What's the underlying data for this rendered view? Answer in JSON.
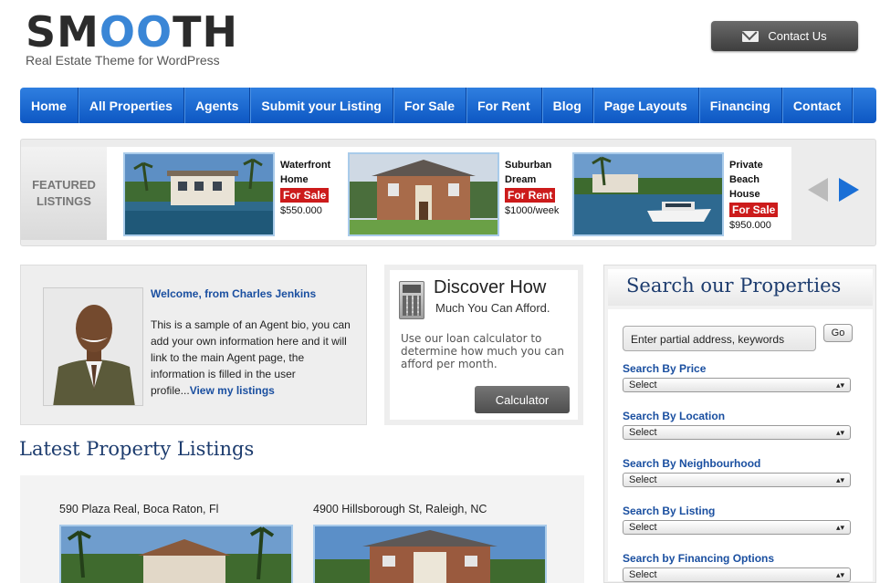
{
  "header": {
    "logo_prefix": "SM",
    "logo_oo": "OO",
    "logo_suffix": "TH",
    "tagline": "Real Estate Theme for WordPress",
    "contact_label": "Contact Us"
  },
  "nav": {
    "items": [
      "Home",
      "All Properties",
      "Agents",
      "Submit your Listing",
      "For Sale",
      "For Rent",
      "Blog",
      "Page Layouts",
      "Financing",
      "Contact"
    ]
  },
  "featured": {
    "label_line1": "FEATURED",
    "label_line2": "LISTINGS",
    "cards": [
      {
        "title_line1": "Waterfront",
        "title_line2": "Home",
        "title_line3": "",
        "badge": "For Sale",
        "price": "$550.000"
      },
      {
        "title_line1": "Suburban",
        "title_line2": "Dream",
        "title_line3": "",
        "badge": "For Rent",
        "price": "$1000/week"
      },
      {
        "title_line1": "Private",
        "title_line2": "Beach",
        "title_line3": "House",
        "badge": "For Sale",
        "price": "$950.000"
      }
    ]
  },
  "agent": {
    "title": "Welcome, from Charles Jenkins",
    "bio": "This is a sample of an Agent bio, you can add your own information here and it will link to the main Agent page, the information is filled in the user profile...",
    "link": "View my listings"
  },
  "calculator": {
    "heading": "Discover How",
    "subheading": "Much You Can Afford.",
    "text": "Use our loan calculator to determine how much you can afford per month.",
    "button": "Calculator"
  },
  "latest": {
    "title": "Latest Property Listings",
    "listings": [
      {
        "address": "590 Plaza Real, Boca Raton, Fl"
      },
      {
        "address": "4900 Hillsborough St, Raleigh, NC"
      }
    ]
  },
  "search": {
    "title": "Search our Properties",
    "placeholder": "Enter partial address, keywords",
    "go": "Go",
    "filters": [
      {
        "label": "Search By Price",
        "value": "Select"
      },
      {
        "label": "Search By Location",
        "value": "Select"
      },
      {
        "label": "Search By Neighbourhood",
        "value": "Select"
      },
      {
        "label": "Search By Listing",
        "value": "Select"
      },
      {
        "label": "Search by Financing Options",
        "value": "Select"
      }
    ]
  },
  "colors": {
    "nav_top": "#2f7fe0",
    "nav_bottom": "#0d57c3",
    "badge": "#cc1b1b",
    "link": "#1a4fa0",
    "heading": "#1d3c6e"
  }
}
